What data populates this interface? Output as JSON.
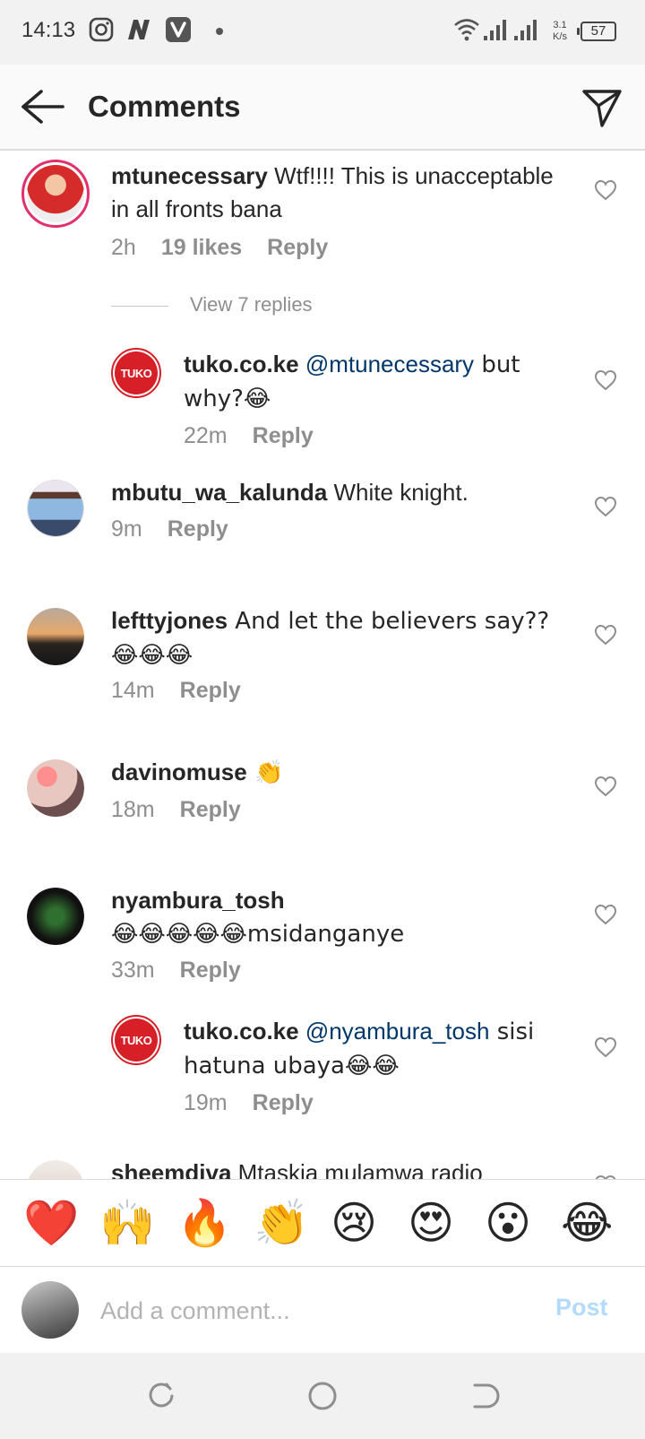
{
  "status_bar": {
    "time": "14:13",
    "network_speed_value": "3.1",
    "network_speed_unit": "K/s",
    "battery": "57",
    "icons": [
      "instagram-icon",
      "n-app-icon",
      "v-app-icon",
      "notification-dot-icon",
      "wifi-icon",
      "signal-icon",
      "signal-icon-2",
      "battery-icon"
    ]
  },
  "header": {
    "title": "Comments",
    "back_icon": "back-arrow-icon",
    "send_icon": "direct-send-icon"
  },
  "comments": [
    {
      "username": "mtunecessary",
      "text": " Wtf!!!! This is unacceptable in all fronts bana",
      "time": "2h",
      "likes": "19 likes",
      "reply_label": "Reply",
      "view_replies": "View 7 replies"
    },
    {
      "username": "tuko.co.ke",
      "mention": "@mtunecessary",
      "text": " but why?😂",
      "time": "22m",
      "reply_label": "Reply",
      "avatar_text": "TUKO"
    },
    {
      "username": "mbutu_wa_kalunda",
      "text": " White knight.",
      "time": "9m",
      "reply_label": "Reply"
    },
    {
      "username": "lefttyjones",
      "text": " And let the believers say??😂😂😂",
      "time": "14m",
      "reply_label": "Reply"
    },
    {
      "username": "davinomuse",
      "text": " 👏",
      "time": "18m",
      "reply_label": "Reply"
    },
    {
      "username": "nyambura_tosh",
      "text": "😂😂😂😂😂msidanganye",
      "time": "33m",
      "reply_label": "Reply"
    },
    {
      "username": "tuko.co.ke",
      "mention": "@nyambura_tosh",
      "text": " sisi hatuna ubaya😂😂",
      "time": "19m",
      "reply_label": "Reply",
      "avatar_text": "TUKO"
    },
    {
      "username": "sheemdiva",
      "text": " Mtaskia mulamwa radio"
    }
  ],
  "emoji_bar": [
    "❤️",
    "🙌",
    "🔥",
    "👏",
    "😢",
    "😍",
    "😮",
    "😂"
  ],
  "comment_input": {
    "placeholder": "Add a comment...",
    "post_label": "Post"
  },
  "colors": {
    "mention": "#00376b",
    "meta_text": "#8e8e8e",
    "post_disabled": "#b3dbff",
    "story_ring": "#e1306c",
    "tuko_red": "#d61f26"
  }
}
